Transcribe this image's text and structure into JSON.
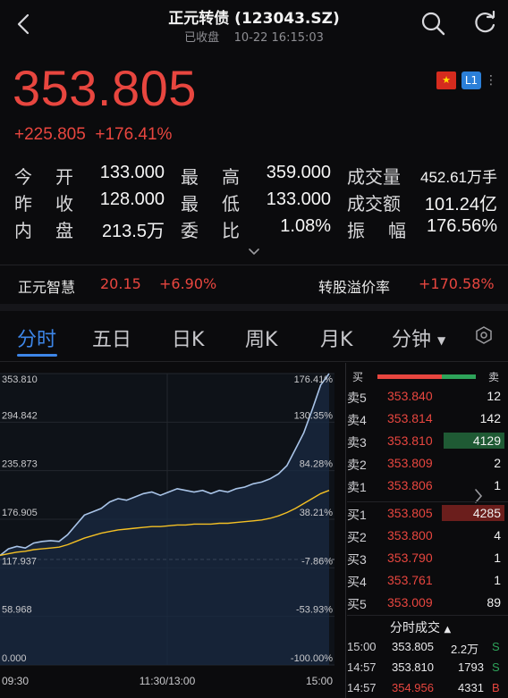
{
  "header": {
    "title": "正元转债 (123043.SZ)",
    "status": "已收盘",
    "datetime": "10-22 16:15:03"
  },
  "quote": {
    "price": "353.805",
    "change": "+225.805",
    "change_pct": "+176.41%",
    "level_badge": "L1",
    "price_color": "#e8463f"
  },
  "stats": [
    {
      "label": "今 开",
      "value": "133.000"
    },
    {
      "label": "最 高",
      "value": "359.000"
    },
    {
      "label": "成交量",
      "value": "452.61万手"
    },
    {
      "label": "昨 收",
      "value": "128.000"
    },
    {
      "label": "最 低",
      "value": "133.000"
    },
    {
      "label": "成交额",
      "value": "101.24亿"
    },
    {
      "label": "内 盘",
      "value": "213.5万"
    },
    {
      "label": "委 比",
      "value": "1.08%"
    },
    {
      "label": "振 幅",
      "value": "176.56%"
    }
  ],
  "underlying": {
    "name": "正元智慧",
    "price": "20.15",
    "change_pct": "+6.90%",
    "premium_label": "转股溢价率",
    "premium_value": "+170.58%"
  },
  "tabs": [
    "分时",
    "五日",
    "日K",
    "周K",
    "月K",
    "分钟"
  ],
  "active_tab": "分时",
  "chart_data": {
    "type": "line",
    "y_labels_left": [
      "353.810",
      "294.842",
      "235.873",
      "176.905",
      "117.937",
      "58.968",
      "0.000"
    ],
    "y_labels_right": [
      "176.41%",
      "130.35%",
      "84.28%",
      "38.21%",
      "-7.86%",
      "-53.93%",
      "-100.00%"
    ],
    "x_labels": [
      "09:30",
      "11:30/13:00",
      "15:00"
    ],
    "ylim": [
      0,
      353.81
    ],
    "prev_close": 128.0,
    "series": [
      {
        "values": [
          133,
          141,
          144,
          142,
          148,
          150,
          151,
          150,
          158,
          170,
          182,
          186,
          190,
          198,
          202,
          200,
          204,
          208,
          210,
          206,
          210,
          214,
          212,
          210,
          212,
          208,
          212,
          210,
          214,
          216,
          220,
          222,
          226,
          232,
          242,
          262,
          282,
          310,
          340,
          353.805
        ],
        "color": "#a9c4e8"
      },
      {
        "values": [
          133,
          135,
          137,
          138,
          140,
          141,
          142,
          143,
          146,
          150,
          154,
          157,
          160,
          162,
          164,
          165,
          166,
          167,
          168,
          168,
          169,
          170,
          170,
          171,
          171,
          171,
          172,
          172,
          173,
          174,
          175,
          176,
          178,
          181,
          185,
          190,
          196,
          202,
          208,
          212
        ],
        "color": "#f4c024"
      }
    ]
  },
  "orderbook": {
    "header_buy": "买",
    "header_sell": "卖",
    "asks": [
      {
        "label": "卖5",
        "price": "353.840",
        "vol": "12"
      },
      {
        "label": "卖4",
        "price": "353.814",
        "vol": "142"
      },
      {
        "label": "卖3",
        "price": "353.810",
        "vol": "4129"
      },
      {
        "label": "卖2",
        "price": "353.809",
        "vol": "2"
      },
      {
        "label": "卖1",
        "price": "353.806",
        "vol": "1"
      }
    ],
    "bids": [
      {
        "label": "买1",
        "price": "353.805",
        "vol": "4285"
      },
      {
        "label": "买2",
        "price": "353.800",
        "vol": "4"
      },
      {
        "label": "买3",
        "price": "353.790",
        "vol": "1"
      },
      {
        "label": "买4",
        "price": "353.761",
        "vol": "1"
      },
      {
        "label": "买5",
        "price": "353.009",
        "vol": "89"
      }
    ]
  },
  "trades": {
    "title": "分时成交",
    "rows": [
      {
        "time": "15:00",
        "price": "353.805",
        "vol": "2.2万",
        "side": "S"
      },
      {
        "time": "14:57",
        "price": "353.810",
        "vol": "1793",
        "side": "S"
      },
      {
        "time": "14:57",
        "price": "354.956",
        "vol": "4331",
        "side": "B"
      }
    ]
  }
}
